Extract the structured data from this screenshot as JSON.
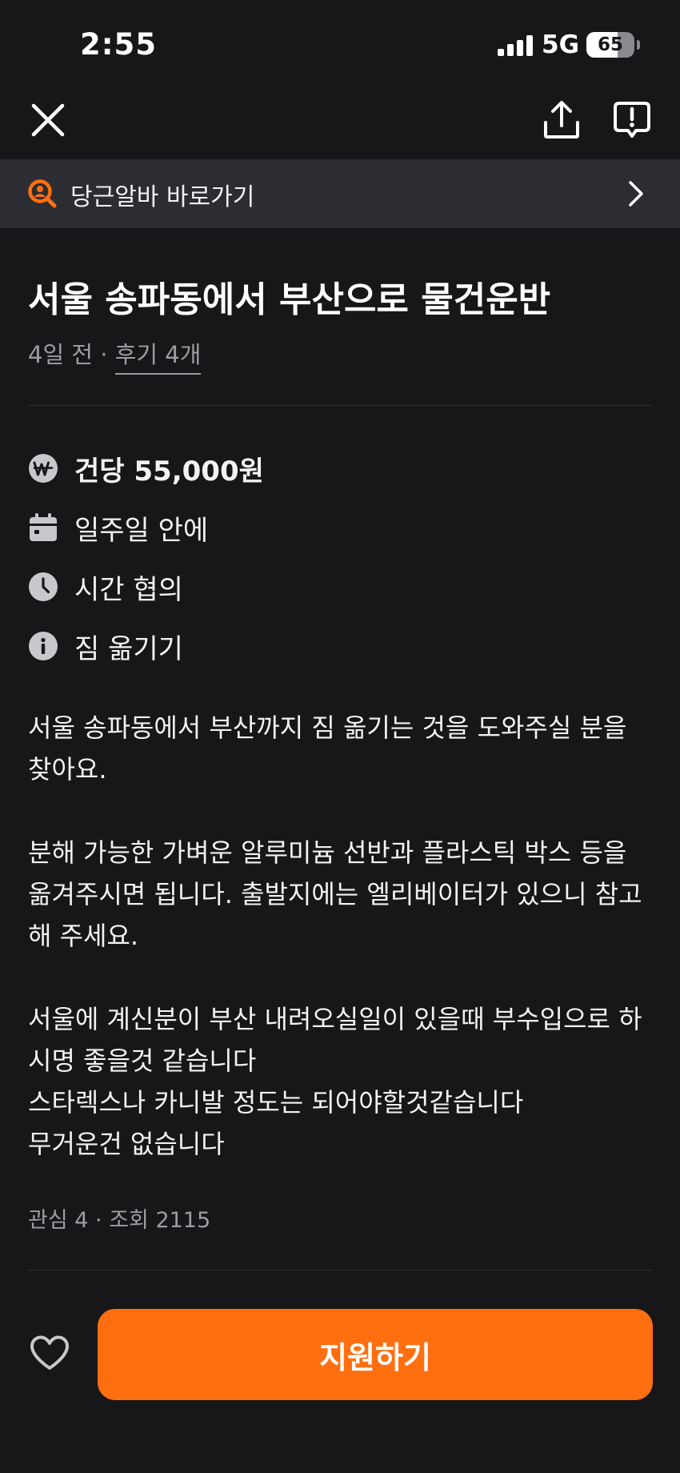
{
  "status_bar": {
    "time": "2:55",
    "network": "5G",
    "battery": "65",
    "battery_level": 0.65
  },
  "nav": {
    "close_icon": "close-icon",
    "share_icon": "share-icon",
    "report_icon": "report-icon"
  },
  "banner": {
    "label": "당근알바 바로가기",
    "icon": "search-person-icon",
    "accent": "#ff6f0f"
  },
  "post": {
    "title": "서울 송파동에서 부산으로 물건운반",
    "time_ago": "4일 전",
    "separator": " · ",
    "reviews": "후기 4개"
  },
  "info": [
    {
      "icon": "won-icon",
      "text": "건당 55,000원"
    },
    {
      "icon": "calendar-icon",
      "text": "일주일 안에"
    },
    {
      "icon": "clock-icon",
      "text": "시간 협의"
    },
    {
      "icon": "info-icon",
      "text": "짐 옮기기"
    }
  ],
  "description": {
    "lines": [
      "서울 송파동에서 부산까지 짐 옮기는 것을 도와주실 분을",
      "찾아요.",
      "",
      "분해 가능한 가벼운 알루미늄 선반과 플라스틱 박스 등을",
      "옮겨주시면 됩니다. 출발지에는 엘리베이터가 있으니 참고",
      "해 주세요.",
      "",
      "서울에 계신분이 부산 내려오실일이 있을때 부수입으로 하",
      "시명 좋을것 같습니다",
      "스타렉스나 카니발 정도는 되어야할것같습니다",
      "무거운건 없습니다"
    ]
  },
  "stats": {
    "text": "관심 4 · 조회 2115"
  },
  "bottom": {
    "like_icon": "heart-icon",
    "apply_label": "지원하기",
    "apply_color": "#ff6f0f"
  }
}
